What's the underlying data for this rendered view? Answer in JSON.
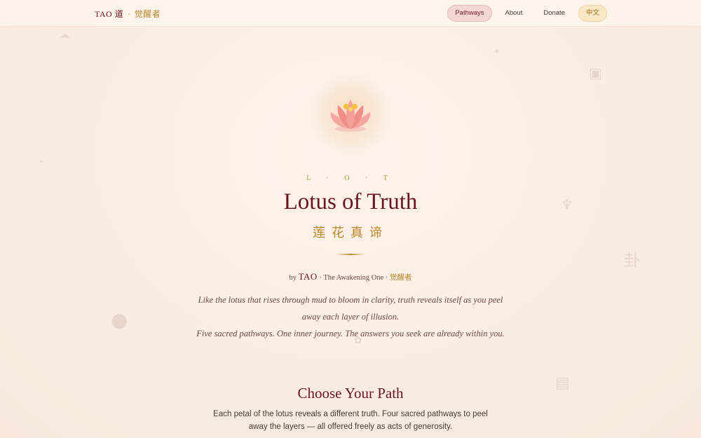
{
  "header": {
    "brand": {
      "latin": "TAO",
      "han": "道",
      "separator": "·",
      "zh": "觉醒者"
    },
    "nav": [
      {
        "label": "Pathways",
        "active": true
      },
      {
        "label": "About",
        "active": false
      },
      {
        "label": "Donate",
        "active": false
      },
      {
        "label": "中文",
        "active": false
      }
    ]
  },
  "hero": {
    "icon": "lotus-icon",
    "eyebrow": "L · O · T",
    "title": "Lotus of Truth",
    "title_zh": "莲花真谛",
    "byline": {
      "prefix": "by",
      "name": "TAO",
      "mid": "· The Awakening One ·",
      "zh": "觉醒者"
    },
    "quote_line1": "Like the lotus that rises through mud to bloom in clarity, truth reveals itself as you peel away each layer of illusion.",
    "quote_line2": "Five sacred pathways. One inner journey. The answers you seek are already within you."
  },
  "section": {
    "title": "Choose Your Path",
    "description": "Each petal of the lotus reveals a different truth. Four sacred pathways to peel away the layers — all offered freely as acts of generosity."
  },
  "colors": {
    "accent": "#6a1420",
    "gold": "#b9862a",
    "background": "#fbeee4",
    "active_nav_bg": "#f4d7d3",
    "lang_nav_bg": "#fbe8c6"
  }
}
